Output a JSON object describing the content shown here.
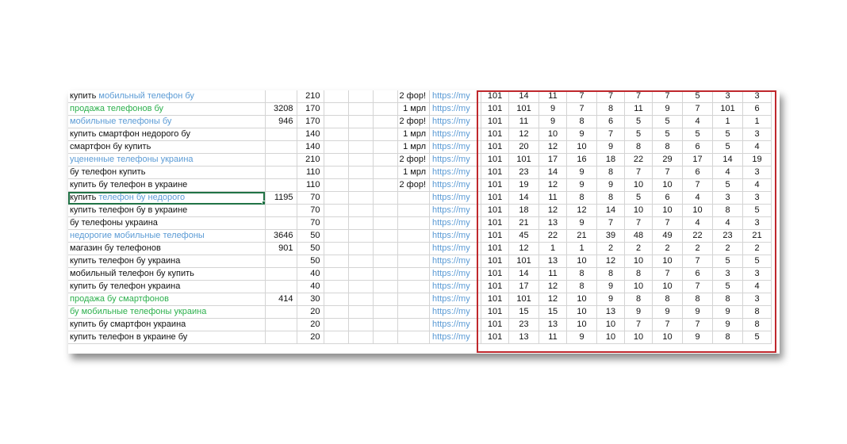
{
  "colors": {
    "blue_text": "#5b9bd5",
    "green_text": "#2db04d",
    "highlight_border": "#c0282d",
    "selection": "#217346"
  },
  "rows": [
    {
      "kw_parts": [
        {
          "t": "купить ",
          "c": "black"
        },
        {
          "t": "мобильный телефон бу",
          "c": "blue"
        }
      ],
      "vol": "",
      "n": "210",
      "note": "2 фор!",
      "url": "https://my",
      "v": [
        "101",
        "14",
        "11",
        "7",
        "7",
        "7",
        "7",
        "5",
        "3",
        "3"
      ]
    },
    {
      "kw_parts": [
        {
          "t": "продажа телефонов бу",
          "c": "green"
        }
      ],
      "vol": "3208",
      "n": "170",
      "note": "1 мрл",
      "url": "https://my",
      "v": [
        "101",
        "101",
        "9",
        "7",
        "8",
        "11",
        "9",
        "7",
        "101",
        "6"
      ]
    },
    {
      "kw_parts": [
        {
          "t": "мобильные телефоны бу",
          "c": "blue"
        }
      ],
      "vol": "946",
      "n": "170",
      "note": "2 фор!",
      "url": "https://my",
      "v": [
        "101",
        "11",
        "9",
        "8",
        "6",
        "5",
        "5",
        "4",
        "1",
        "1"
      ]
    },
    {
      "kw_parts": [
        {
          "t": "купить смартфон недорого бу",
          "c": "black"
        }
      ],
      "vol": "",
      "n": "140",
      "note": "1 мрл",
      "url": "https://my",
      "v": [
        "101",
        "12",
        "10",
        "9",
        "7",
        "5",
        "5",
        "5",
        "5",
        "3"
      ]
    },
    {
      "kw_parts": [
        {
          "t": "смартфон бу купить",
          "c": "black"
        }
      ],
      "vol": "",
      "n": "140",
      "note": "1 мрл",
      "url": "https://my",
      "v": [
        "101",
        "20",
        "12",
        "10",
        "9",
        "8",
        "8",
        "6",
        "5",
        "4"
      ]
    },
    {
      "kw_parts": [
        {
          "t": "уцененные телефоны украина",
          "c": "blue"
        }
      ],
      "vol": "",
      "n": "210",
      "note": "2 фор!",
      "url": "https://my",
      "v": [
        "101",
        "101",
        "17",
        "16",
        "18",
        "22",
        "29",
        "17",
        "14",
        "19"
      ]
    },
    {
      "kw_parts": [
        {
          "t": "бу телефон купить",
          "c": "black"
        }
      ],
      "vol": "",
      "n": "110",
      "note": "1 мрл",
      "url": "https://my",
      "v": [
        "101",
        "23",
        "14",
        "9",
        "8",
        "7",
        "7",
        "6",
        "4",
        "3"
      ]
    },
    {
      "kw_parts": [
        {
          "t": "купить бу телефон в украине",
          "c": "black"
        }
      ],
      "vol": "",
      "n": "110",
      "note": "2 фор!",
      "url": "https://my",
      "v": [
        "101",
        "19",
        "12",
        "9",
        "9",
        "10",
        "10",
        "7",
        "5",
        "4"
      ]
    },
    {
      "kw_parts": [
        {
          "t": "купить ",
          "c": "black"
        },
        {
          "t": "телефон бу недорого",
          "c": "blue"
        }
      ],
      "vol": "1195",
      "n": "70",
      "note": "",
      "url": "https://my",
      "v": [
        "101",
        "14",
        "11",
        "8",
        "8",
        "5",
        "6",
        "4",
        "3",
        "3"
      ],
      "selected": true
    },
    {
      "kw_parts": [
        {
          "t": "купить телефон бу в украине",
          "c": "black"
        }
      ],
      "vol": "",
      "n": "70",
      "note": "",
      "url": "https://my",
      "v": [
        "101",
        "18",
        "12",
        "12",
        "14",
        "10",
        "10",
        "10",
        "8",
        "5"
      ]
    },
    {
      "kw_parts": [
        {
          "t": "бу телефоны украина",
          "c": "black"
        }
      ],
      "vol": "",
      "n": "70",
      "note": "",
      "url": "https://my",
      "v": [
        "101",
        "21",
        "13",
        "9",
        "7",
        "7",
        "7",
        "4",
        "4",
        "3"
      ]
    },
    {
      "kw_parts": [
        {
          "t": "недорогие мобильные телефоны",
          "c": "blue"
        }
      ],
      "vol": "3646",
      "n": "50",
      "note": "",
      "url": "https://my",
      "v": [
        "101",
        "45",
        "22",
        "21",
        "39",
        "48",
        "49",
        "22",
        "23",
        "21"
      ]
    },
    {
      "kw_parts": [
        {
          "t": "магазин бу телефонов",
          "c": "black"
        }
      ],
      "vol": "901",
      "n": "50",
      "note": "",
      "url": "https://my",
      "v": [
        "101",
        "12",
        "1",
        "1",
        "2",
        "2",
        "2",
        "2",
        "2",
        "2"
      ]
    },
    {
      "kw_parts": [
        {
          "t": "купить телефон бу украина",
          "c": "black"
        }
      ],
      "vol": "",
      "n": "50",
      "note": "",
      "url": "https://my",
      "v": [
        "101",
        "101",
        "13",
        "10",
        "12",
        "10",
        "10",
        "7",
        "5",
        "5"
      ]
    },
    {
      "kw_parts": [
        {
          "t": "мобильный телефон бу купить",
          "c": "black"
        }
      ],
      "vol": "",
      "n": "40",
      "note": "",
      "url": "https://my",
      "v": [
        "101",
        "14",
        "11",
        "8",
        "8",
        "8",
        "7",
        "6",
        "3",
        "3"
      ]
    },
    {
      "kw_parts": [
        {
          "t": "купить бу телефон украина",
          "c": "black"
        }
      ],
      "vol": "",
      "n": "40",
      "note": "",
      "url": "https://my",
      "v": [
        "101",
        "17",
        "12",
        "8",
        "9",
        "10",
        "10",
        "7",
        "5",
        "4"
      ]
    },
    {
      "kw_parts": [
        {
          "t": "продажа бу смартфонов",
          "c": "green"
        }
      ],
      "vol": "414",
      "n": "30",
      "note": "",
      "url": "https://my",
      "v": [
        "101",
        "101",
        "12",
        "10",
        "9",
        "8",
        "8",
        "8",
        "8",
        "3"
      ]
    },
    {
      "kw_parts": [
        {
          "t": "бу мобильные телефоны украина",
          "c": "green"
        }
      ],
      "vol": "",
      "n": "20",
      "note": "",
      "url": "https://my",
      "v": [
        "101",
        "15",
        "15",
        "10",
        "13",
        "9",
        "9",
        "9",
        "9",
        "8"
      ]
    },
    {
      "kw_parts": [
        {
          "t": "купить бу смартфон украина",
          "c": "black"
        }
      ],
      "vol": "",
      "n": "20",
      "note": "",
      "url": "https://my",
      "v": [
        "101",
        "23",
        "13",
        "10",
        "10",
        "7",
        "7",
        "7",
        "9",
        "8"
      ]
    },
    {
      "kw_parts": [
        {
          "t": "купить телефон в украине бу",
          "c": "black"
        }
      ],
      "vol": "",
      "n": "20",
      "note": "",
      "url": "https://my",
      "v": [
        "101",
        "13",
        "11",
        "9",
        "10",
        "10",
        "10",
        "9",
        "8",
        "5"
      ]
    }
  ]
}
